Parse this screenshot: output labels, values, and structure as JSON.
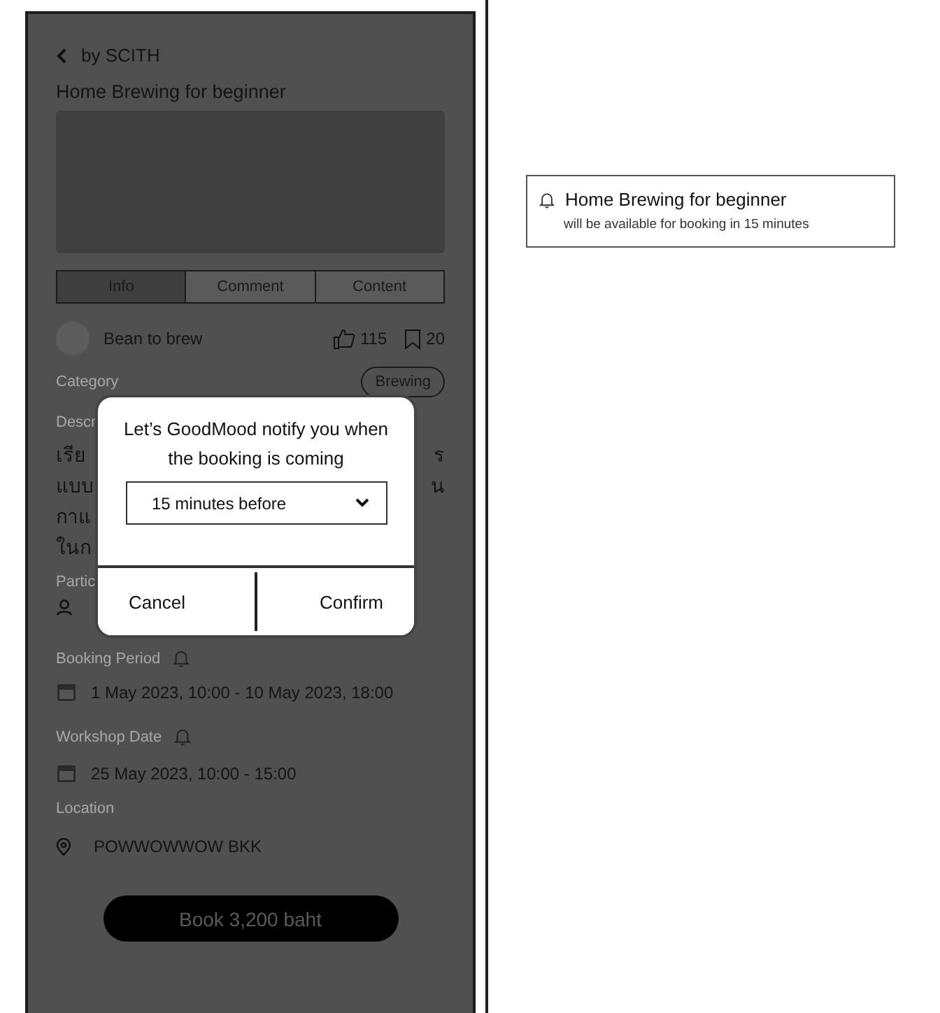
{
  "phone": {
    "byline": "by SCITH",
    "title": "Home Brewing for beginner",
    "tabs": [
      {
        "label": "Info",
        "selected": true
      },
      {
        "label": "Comment",
        "selected": false
      },
      {
        "label": "Content",
        "selected": false
      }
    ],
    "host": "Bean to brew",
    "likes": "115",
    "saves": "20",
    "category_label": "Category",
    "category_tag": "Brewing",
    "description_label": "Descr",
    "description_lines": [
      {
        "left": "เรีย",
        "right": "ร"
      },
      {
        "left": "แบบ",
        "right": "น"
      },
      {
        "left": "กาแ"
      },
      {
        "left": "ในก"
      }
    ],
    "participants_label": "Partic",
    "booking_label": "Booking Period",
    "booking_period": "1 May 2023, 10:00  -  10 May 2023, 18:00",
    "workshop_label": "Workshop Date",
    "workshop_date": "25 May 2023, 10:00 - 15:00",
    "location_label": "Location",
    "location": "POWWOWWOW BKK",
    "book_button": "Book 3,200 baht"
  },
  "dialog": {
    "message": "Let’s GoodMood notify you when the booking is coming",
    "select_value": "15 minutes before",
    "buttons": [
      "Cancel",
      "Confirm"
    ]
  },
  "notification": {
    "title": "Home Brewing for beginner",
    "body": "will be available for booking in 15 minutes"
  }
}
